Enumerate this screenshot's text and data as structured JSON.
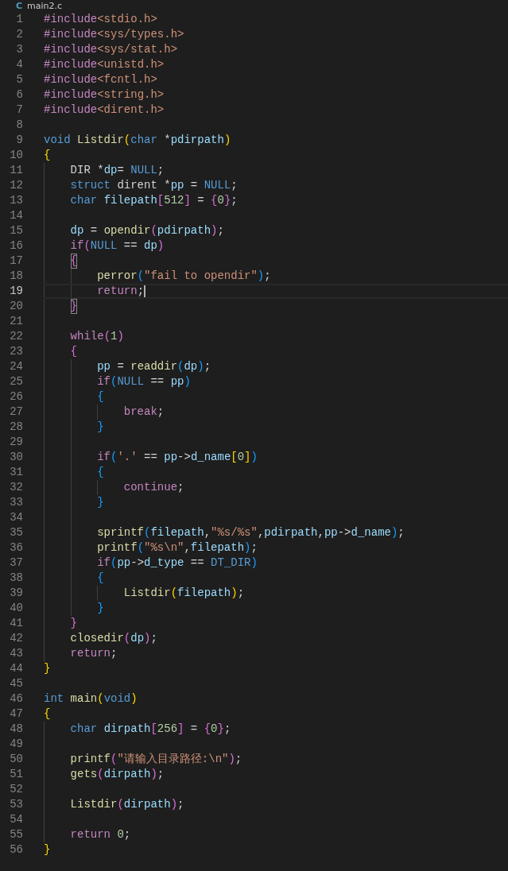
{
  "tab": {
    "icon": "C",
    "title": "main2.c"
  },
  "lines": [
    {
      "number": "1",
      "tokens": [
        {
          "kind": "dir",
          "text": "#include"
        },
        {
          "kind": "str",
          "text": "<stdio.h>"
        }
      ]
    },
    {
      "number": "2",
      "tokens": [
        {
          "kind": "dir",
          "text": "#include"
        },
        {
          "kind": "str",
          "text": "<sys/types.h>"
        }
      ]
    },
    {
      "number": "3",
      "tokens": [
        {
          "kind": "dir",
          "text": "#include"
        },
        {
          "kind": "str",
          "text": "<sys/stat.h>"
        }
      ]
    },
    {
      "number": "4",
      "tokens": [
        {
          "kind": "dir",
          "text": "#include"
        },
        {
          "kind": "str",
          "text": "<unistd.h>"
        }
      ]
    },
    {
      "number": "5",
      "tokens": [
        {
          "kind": "dir",
          "text": "#include"
        },
        {
          "kind": "str",
          "text": "<fcntl.h>"
        }
      ]
    },
    {
      "number": "6",
      "tokens": [
        {
          "kind": "dir",
          "text": "#include"
        },
        {
          "kind": "str",
          "text": "<string.h>"
        }
      ]
    },
    {
      "number": "7",
      "tokens": [
        {
          "kind": "dir",
          "text": "#include"
        },
        {
          "kind": "str",
          "text": "<dirent.h>"
        }
      ]
    },
    {
      "number": "8"
    },
    {
      "number": "9",
      "tokens": [
        {
          "kind": "type",
          "text": "void "
        },
        {
          "kind": "fn",
          "text": "Listdir"
        },
        {
          "kind": "b1",
          "text": "("
        },
        {
          "kind": "type",
          "text": "char"
        },
        {
          "kind": "plain",
          "text": " *"
        },
        {
          "kind": "var",
          "text": "pdirpath"
        },
        {
          "kind": "b1",
          "text": ")"
        }
      ]
    },
    {
      "number": "10",
      "tokens": [
        {
          "kind": "b1",
          "text": "{"
        }
      ]
    },
    {
      "number": "11",
      "tokens": [
        {
          "kind": "plain",
          "text": "    DIR *"
        },
        {
          "kind": "var",
          "text": "dp"
        },
        {
          "kind": "plain",
          "text": "= "
        },
        {
          "kind": "const",
          "text": "NULL"
        },
        {
          "kind": "plain",
          "text": ";"
        }
      ]
    },
    {
      "number": "12",
      "tokens": [
        {
          "kind": "type",
          "text": "    struct"
        },
        {
          "kind": "plain",
          "text": " dirent *"
        },
        {
          "kind": "var",
          "text": "pp"
        },
        {
          "kind": "plain",
          "text": " = "
        },
        {
          "kind": "const",
          "text": "NULL"
        },
        {
          "kind": "plain",
          "text": ";"
        }
      ]
    },
    {
      "number": "13",
      "tokens": [
        {
          "kind": "type",
          "text": "    char "
        },
        {
          "kind": "var",
          "text": "filepath"
        },
        {
          "kind": "b2",
          "text": "["
        },
        {
          "kind": "num",
          "text": "512"
        },
        {
          "kind": "b2",
          "text": "]"
        },
        {
          "kind": "plain",
          "text": " = "
        },
        {
          "kind": "b2",
          "text": "{"
        },
        {
          "kind": "num",
          "text": "0"
        },
        {
          "kind": "b2",
          "text": "}"
        },
        {
          "kind": "plain",
          "text": ";"
        }
      ]
    },
    {
      "number": "14"
    },
    {
      "number": "15",
      "tokens": [
        {
          "kind": "var",
          "text": "    dp"
        },
        {
          "kind": "plain",
          "text": " = "
        },
        {
          "kind": "fn",
          "text": "opendir"
        },
        {
          "kind": "b2",
          "text": "("
        },
        {
          "kind": "var",
          "text": "pdirpath"
        },
        {
          "kind": "b2",
          "text": ")"
        },
        {
          "kind": "plain",
          "text": ";"
        }
      ]
    },
    {
      "number": "16",
      "tokens": [
        {
          "kind": "kw",
          "text": "    if"
        },
        {
          "kind": "b2",
          "text": "("
        },
        {
          "kind": "const",
          "text": "NULL"
        },
        {
          "kind": "plain",
          "text": " == "
        },
        {
          "kind": "var",
          "text": "dp"
        },
        {
          "kind": "b2",
          "text": ")"
        }
      ]
    },
    {
      "number": "17",
      "tokens": [
        {
          "kind": "b2",
          "text": "    {",
          "matched": true
        }
      ]
    },
    {
      "number": "18",
      "tokens": [
        {
          "kind": "fn",
          "text": "        perror"
        },
        {
          "kind": "b3",
          "text": "("
        },
        {
          "kind": "str",
          "text": "\"fail to opendir\""
        },
        {
          "kind": "b3",
          "text": ")"
        },
        {
          "kind": "plain",
          "text": ";"
        }
      ]
    },
    {
      "number": "19",
      "current": true,
      "tokens": [
        {
          "kind": "kw",
          "text": "        return"
        },
        {
          "kind": "plain",
          "text": ";"
        }
      ]
    },
    {
      "number": "20",
      "tokens": [
        {
          "kind": "b2",
          "text": "    }",
          "matched": true
        }
      ]
    },
    {
      "number": "21"
    },
    {
      "number": "22",
      "tokens": [
        {
          "kind": "kw",
          "text": "    while"
        },
        {
          "kind": "b2",
          "text": "("
        },
        {
          "kind": "num",
          "text": "1"
        },
        {
          "kind": "b2",
          "text": ")"
        }
      ]
    },
    {
      "number": "23",
      "tokens": [
        {
          "kind": "b2",
          "text": "    {"
        }
      ]
    },
    {
      "number": "24",
      "tokens": [
        {
          "kind": "var",
          "text": "        pp"
        },
        {
          "kind": "plain",
          "text": " = "
        },
        {
          "kind": "fn",
          "text": "readdir"
        },
        {
          "kind": "b3",
          "text": "("
        },
        {
          "kind": "var",
          "text": "dp"
        },
        {
          "kind": "b3",
          "text": ")"
        },
        {
          "kind": "plain",
          "text": ";"
        }
      ]
    },
    {
      "number": "25",
      "tokens": [
        {
          "kind": "kw",
          "text": "        if"
        },
        {
          "kind": "b3",
          "text": "("
        },
        {
          "kind": "const",
          "text": "NULL"
        },
        {
          "kind": "plain",
          "text": " == "
        },
        {
          "kind": "var",
          "text": "pp"
        },
        {
          "kind": "b3",
          "text": ")"
        }
      ]
    },
    {
      "number": "26",
      "tokens": [
        {
          "kind": "b3",
          "text": "        {"
        }
      ]
    },
    {
      "number": "27",
      "tokens": [
        {
          "kind": "kw",
          "text": "            break"
        },
        {
          "kind": "plain",
          "text": ";"
        }
      ]
    },
    {
      "number": "28",
      "tokens": [
        {
          "kind": "b3",
          "text": "        }"
        }
      ]
    },
    {
      "number": "29"
    },
    {
      "number": "30",
      "tokens": [
        {
          "kind": "kw",
          "text": "        if"
        },
        {
          "kind": "b3",
          "text": "("
        },
        {
          "kind": "str",
          "text": "'.'"
        },
        {
          "kind": "plain",
          "text": " == "
        },
        {
          "kind": "var",
          "text": "pp"
        },
        {
          "kind": "plain",
          "text": "->"
        },
        {
          "kind": "var",
          "text": "d_name"
        },
        {
          "kind": "b1",
          "text": "["
        },
        {
          "kind": "num",
          "text": "0"
        },
        {
          "kind": "b1",
          "text": "]"
        },
        {
          "kind": "b3",
          "text": ")"
        }
      ]
    },
    {
      "number": "31",
      "tokens": [
        {
          "kind": "b3",
          "text": "        {"
        }
      ]
    },
    {
      "number": "32",
      "tokens": [
        {
          "kind": "kw",
          "text": "            continue"
        },
        {
          "kind": "plain",
          "text": ";"
        }
      ]
    },
    {
      "number": "33",
      "tokens": [
        {
          "kind": "b3",
          "text": "        }"
        }
      ]
    },
    {
      "number": "34"
    },
    {
      "number": "35",
      "tokens": [
        {
          "kind": "fn",
          "text": "        sprintf"
        },
        {
          "kind": "b3",
          "text": "("
        },
        {
          "kind": "var",
          "text": "filepath"
        },
        {
          "kind": "plain",
          "text": ","
        },
        {
          "kind": "str",
          "text": "\"%s/%s\""
        },
        {
          "kind": "plain",
          "text": ","
        },
        {
          "kind": "var",
          "text": "pdirpath"
        },
        {
          "kind": "plain",
          "text": ","
        },
        {
          "kind": "var",
          "text": "pp"
        },
        {
          "kind": "plain",
          "text": "->"
        },
        {
          "kind": "var",
          "text": "d_name"
        },
        {
          "kind": "b3",
          "text": ")"
        },
        {
          "kind": "plain",
          "text": ";"
        }
      ]
    },
    {
      "number": "36",
      "tokens": [
        {
          "kind": "fn",
          "text": "        printf"
        },
        {
          "kind": "b3",
          "text": "("
        },
        {
          "kind": "str",
          "text": "\"%s\\n\""
        },
        {
          "kind": "plain",
          "text": ","
        },
        {
          "kind": "var",
          "text": "filepath"
        },
        {
          "kind": "b3",
          "text": ")"
        },
        {
          "kind": "plain",
          "text": ";"
        }
      ]
    },
    {
      "number": "37",
      "tokens": [
        {
          "kind": "kw",
          "text": "        if"
        },
        {
          "kind": "b3",
          "text": "("
        },
        {
          "kind": "var",
          "text": "pp"
        },
        {
          "kind": "plain",
          "text": "->"
        },
        {
          "kind": "var",
          "text": "d_type"
        },
        {
          "kind": "plain",
          "text": " == "
        },
        {
          "kind": "const",
          "text": "DT_DIR"
        },
        {
          "kind": "b3",
          "text": ")"
        }
      ]
    },
    {
      "number": "38",
      "tokens": [
        {
          "kind": "b3",
          "text": "        {"
        }
      ]
    },
    {
      "number": "39",
      "tokens": [
        {
          "kind": "fn",
          "text": "            Listdir"
        },
        {
          "kind": "b1",
          "text": "("
        },
        {
          "kind": "var",
          "text": "filepath"
        },
        {
          "kind": "b1",
          "text": ")"
        },
        {
          "kind": "plain",
          "text": ";"
        }
      ]
    },
    {
      "number": "40",
      "tokens": [
        {
          "kind": "b3",
          "text": "        }"
        }
      ]
    },
    {
      "number": "41",
      "tokens": [
        {
          "kind": "b2",
          "text": "    }"
        }
      ]
    },
    {
      "number": "42",
      "tokens": [
        {
          "kind": "fn",
          "text": "    closedir"
        },
        {
          "kind": "b2",
          "text": "("
        },
        {
          "kind": "var",
          "text": "dp"
        },
        {
          "kind": "b2",
          "text": ")"
        },
        {
          "kind": "plain",
          "text": ";"
        }
      ]
    },
    {
      "number": "43",
      "tokens": [
        {
          "kind": "kw",
          "text": "    return"
        },
        {
          "kind": "plain",
          "text": ";"
        }
      ]
    },
    {
      "number": "44",
      "tokens": [
        {
          "kind": "b1",
          "text": "}"
        }
      ]
    },
    {
      "number": "45"
    },
    {
      "number": "46",
      "tokens": [
        {
          "kind": "type",
          "text": "int "
        },
        {
          "kind": "fn",
          "text": "main"
        },
        {
          "kind": "b1",
          "text": "("
        },
        {
          "kind": "type",
          "text": "void"
        },
        {
          "kind": "b1",
          "text": ")"
        }
      ]
    },
    {
      "number": "47",
      "tokens": [
        {
          "kind": "b1",
          "text": "{"
        }
      ]
    },
    {
      "number": "48",
      "tokens": [
        {
          "kind": "type",
          "text": "    char "
        },
        {
          "kind": "var",
          "text": "dirpath"
        },
        {
          "kind": "b2",
          "text": "["
        },
        {
          "kind": "num",
          "text": "256"
        },
        {
          "kind": "b2",
          "text": "]"
        },
        {
          "kind": "plain",
          "text": " = "
        },
        {
          "kind": "b2",
          "text": "{"
        },
        {
          "kind": "num",
          "text": "0"
        },
        {
          "kind": "b2",
          "text": "}"
        },
        {
          "kind": "plain",
          "text": ";"
        }
      ]
    },
    {
      "number": "49"
    },
    {
      "number": "50",
      "tokens": [
        {
          "kind": "fn",
          "text": "    printf"
        },
        {
          "kind": "b2",
          "text": "("
        },
        {
          "kind": "str",
          "text": "\"请输入目录路径:\\n\""
        },
        {
          "kind": "b2",
          "text": ")"
        },
        {
          "kind": "plain",
          "text": ";"
        }
      ]
    },
    {
      "number": "51",
      "tokens": [
        {
          "kind": "fn",
          "text": "    gets"
        },
        {
          "kind": "b2",
          "text": "("
        },
        {
          "kind": "var",
          "text": "dirpath"
        },
        {
          "kind": "b2",
          "text": ")"
        },
        {
          "kind": "plain",
          "text": ";"
        }
      ]
    },
    {
      "number": "52"
    },
    {
      "number": "53",
      "tokens": [
        {
          "kind": "fn",
          "text": "    Listdir"
        },
        {
          "kind": "b2",
          "text": "("
        },
        {
          "kind": "var",
          "text": "dirpath"
        },
        {
          "kind": "b2",
          "text": ")"
        },
        {
          "kind": "plain",
          "text": ";"
        }
      ]
    },
    {
      "number": "54"
    },
    {
      "number": "55",
      "tokens": [
        {
          "kind": "kw",
          "text": "    return "
        },
        {
          "kind": "num",
          "text": "0"
        },
        {
          "kind": "plain",
          "text": ";"
        }
      ]
    },
    {
      "number": "56",
      "tokens": [
        {
          "kind": "b1",
          "text": "}"
        }
      ]
    }
  ]
}
